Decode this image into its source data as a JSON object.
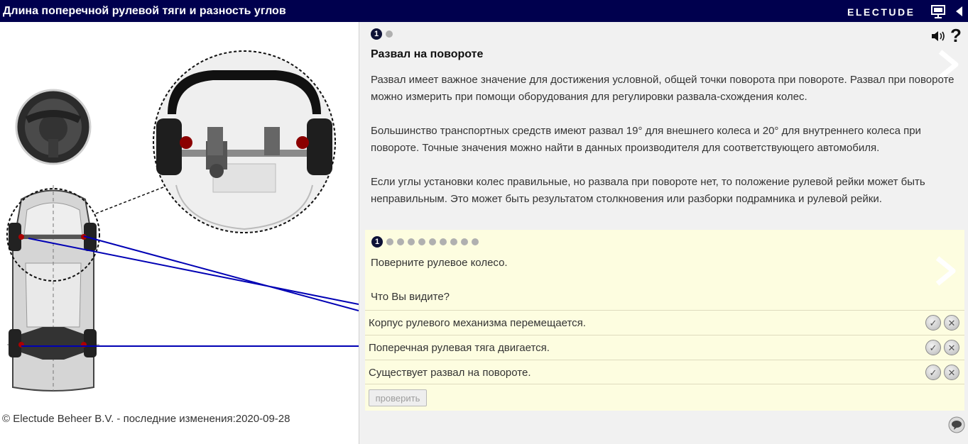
{
  "header": {
    "title": "Длина поперечной рулевой тяги и разность углов",
    "brand": "ELECTUDE",
    "present_icon": "presentation-screen-icon",
    "collapse_icon": "triangle-left-icon"
  },
  "footer": {
    "copyright": "© Electude Beheer B.V. - последние изменения:2020-09-28"
  },
  "illustration": {
    "steering_wheel_icon": "steering-wheel-icon"
  },
  "content": {
    "pager": {
      "active": "1",
      "total": 2
    },
    "heading": "Развал на повороте",
    "paragraphs": [
      "Развал имеет важное значение для достижения условной, общей точки поворота при повороте. Развал при повороте можно измерить при помощи оборудования для регулировки развала-схождения колес.",
      "Большинство транспортных средств имеют развал 19° для внешнего колеса и 20° для внутреннего колеса при повороте. Точные значения можно найти в данных производителя для соответствующего автомобиля.",
      "Если углы установки колес правильные, но развала при повороте нет, то положение рулевой рейки может быть неправильным. Это может быть результатом столкновения или разборки подрамника и рулевой рейки."
    ],
    "icons": {
      "sound": "speaker-icon",
      "help": "?"
    }
  },
  "quiz": {
    "pager": {
      "active": "1",
      "total": 10
    },
    "instruction": "Поверните рулевое колесо.",
    "question": "Что Вы видите?",
    "answers": [
      "Корпус рулевого механизма перемещается.",
      "Поперечная рулевая тяга двигается.",
      "Существует развал на повороте."
    ],
    "check_label": "проверить"
  },
  "colors": {
    "header_bg": "#00004e",
    "panel_bg": "#f1f1f1",
    "quiz_bg": "#fdfde0",
    "pointer_lines": "#0000b4"
  }
}
